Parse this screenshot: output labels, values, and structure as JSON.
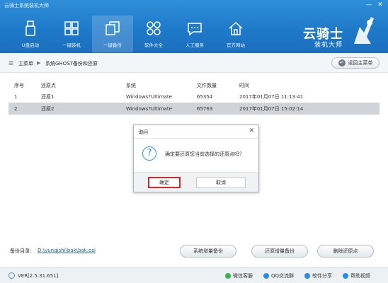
{
  "window": {
    "title": "云骑士系统装机大师",
    "minimize": "—",
    "close": "✕"
  },
  "nav": [
    {
      "label": "U盘启动",
      "icon": "usb-icon"
    },
    {
      "label": "一键装机",
      "icon": "windows-icon"
    },
    {
      "label": "一键备份",
      "icon": "backup-icon"
    },
    {
      "label": "软件大全",
      "icon": "apps-icon"
    },
    {
      "label": "人工服务",
      "icon": "chat-icon"
    },
    {
      "label": "官方网站",
      "icon": "home-icon"
    }
  ],
  "logo": {
    "name": "云骑士",
    "subtitle": "装机大师"
  },
  "breadcrumb": {
    "root": "主菜单",
    "separator": "▶",
    "current": "系统GHOST备份和还原",
    "back_label": "返回主菜单"
  },
  "table": {
    "headers": [
      "序号",
      "还原点",
      "系统",
      "文件数量",
      "时间"
    ],
    "rows": [
      {
        "no": "1",
        "point": "还原1",
        "system": "Windows?Ultimate",
        "count": "65354",
        "time": "2017年01月07日 11:13:41"
      },
      {
        "no": "2",
        "point": "还原2",
        "system": "Windows?Ultimate",
        "count": "65763",
        "time": "2017年01月07日 15:02:14"
      }
    ],
    "selected_index": 1
  },
  "dialog": {
    "title": "询问",
    "close": "✕",
    "message": "确定要还原您当前选择的还原点吗？",
    "ok_label": "确定",
    "cancel_label": "取消"
  },
  "footer": {
    "backup_dir_label": "备份目录：",
    "backup_dir_path": "D:\\yunqishi\\bak\\bak.osi",
    "buttons": [
      "系统增量备份",
      "还原增量备份",
      "删除还原点"
    ]
  },
  "statusbar": {
    "version": "VER[2.5.31.651]",
    "items": [
      "微信客服",
      "QQ交流群",
      "软件分享",
      "帮助视频"
    ]
  },
  "colors": {
    "header": "#1e78c8",
    "accent": "#d62a2a"
  }
}
